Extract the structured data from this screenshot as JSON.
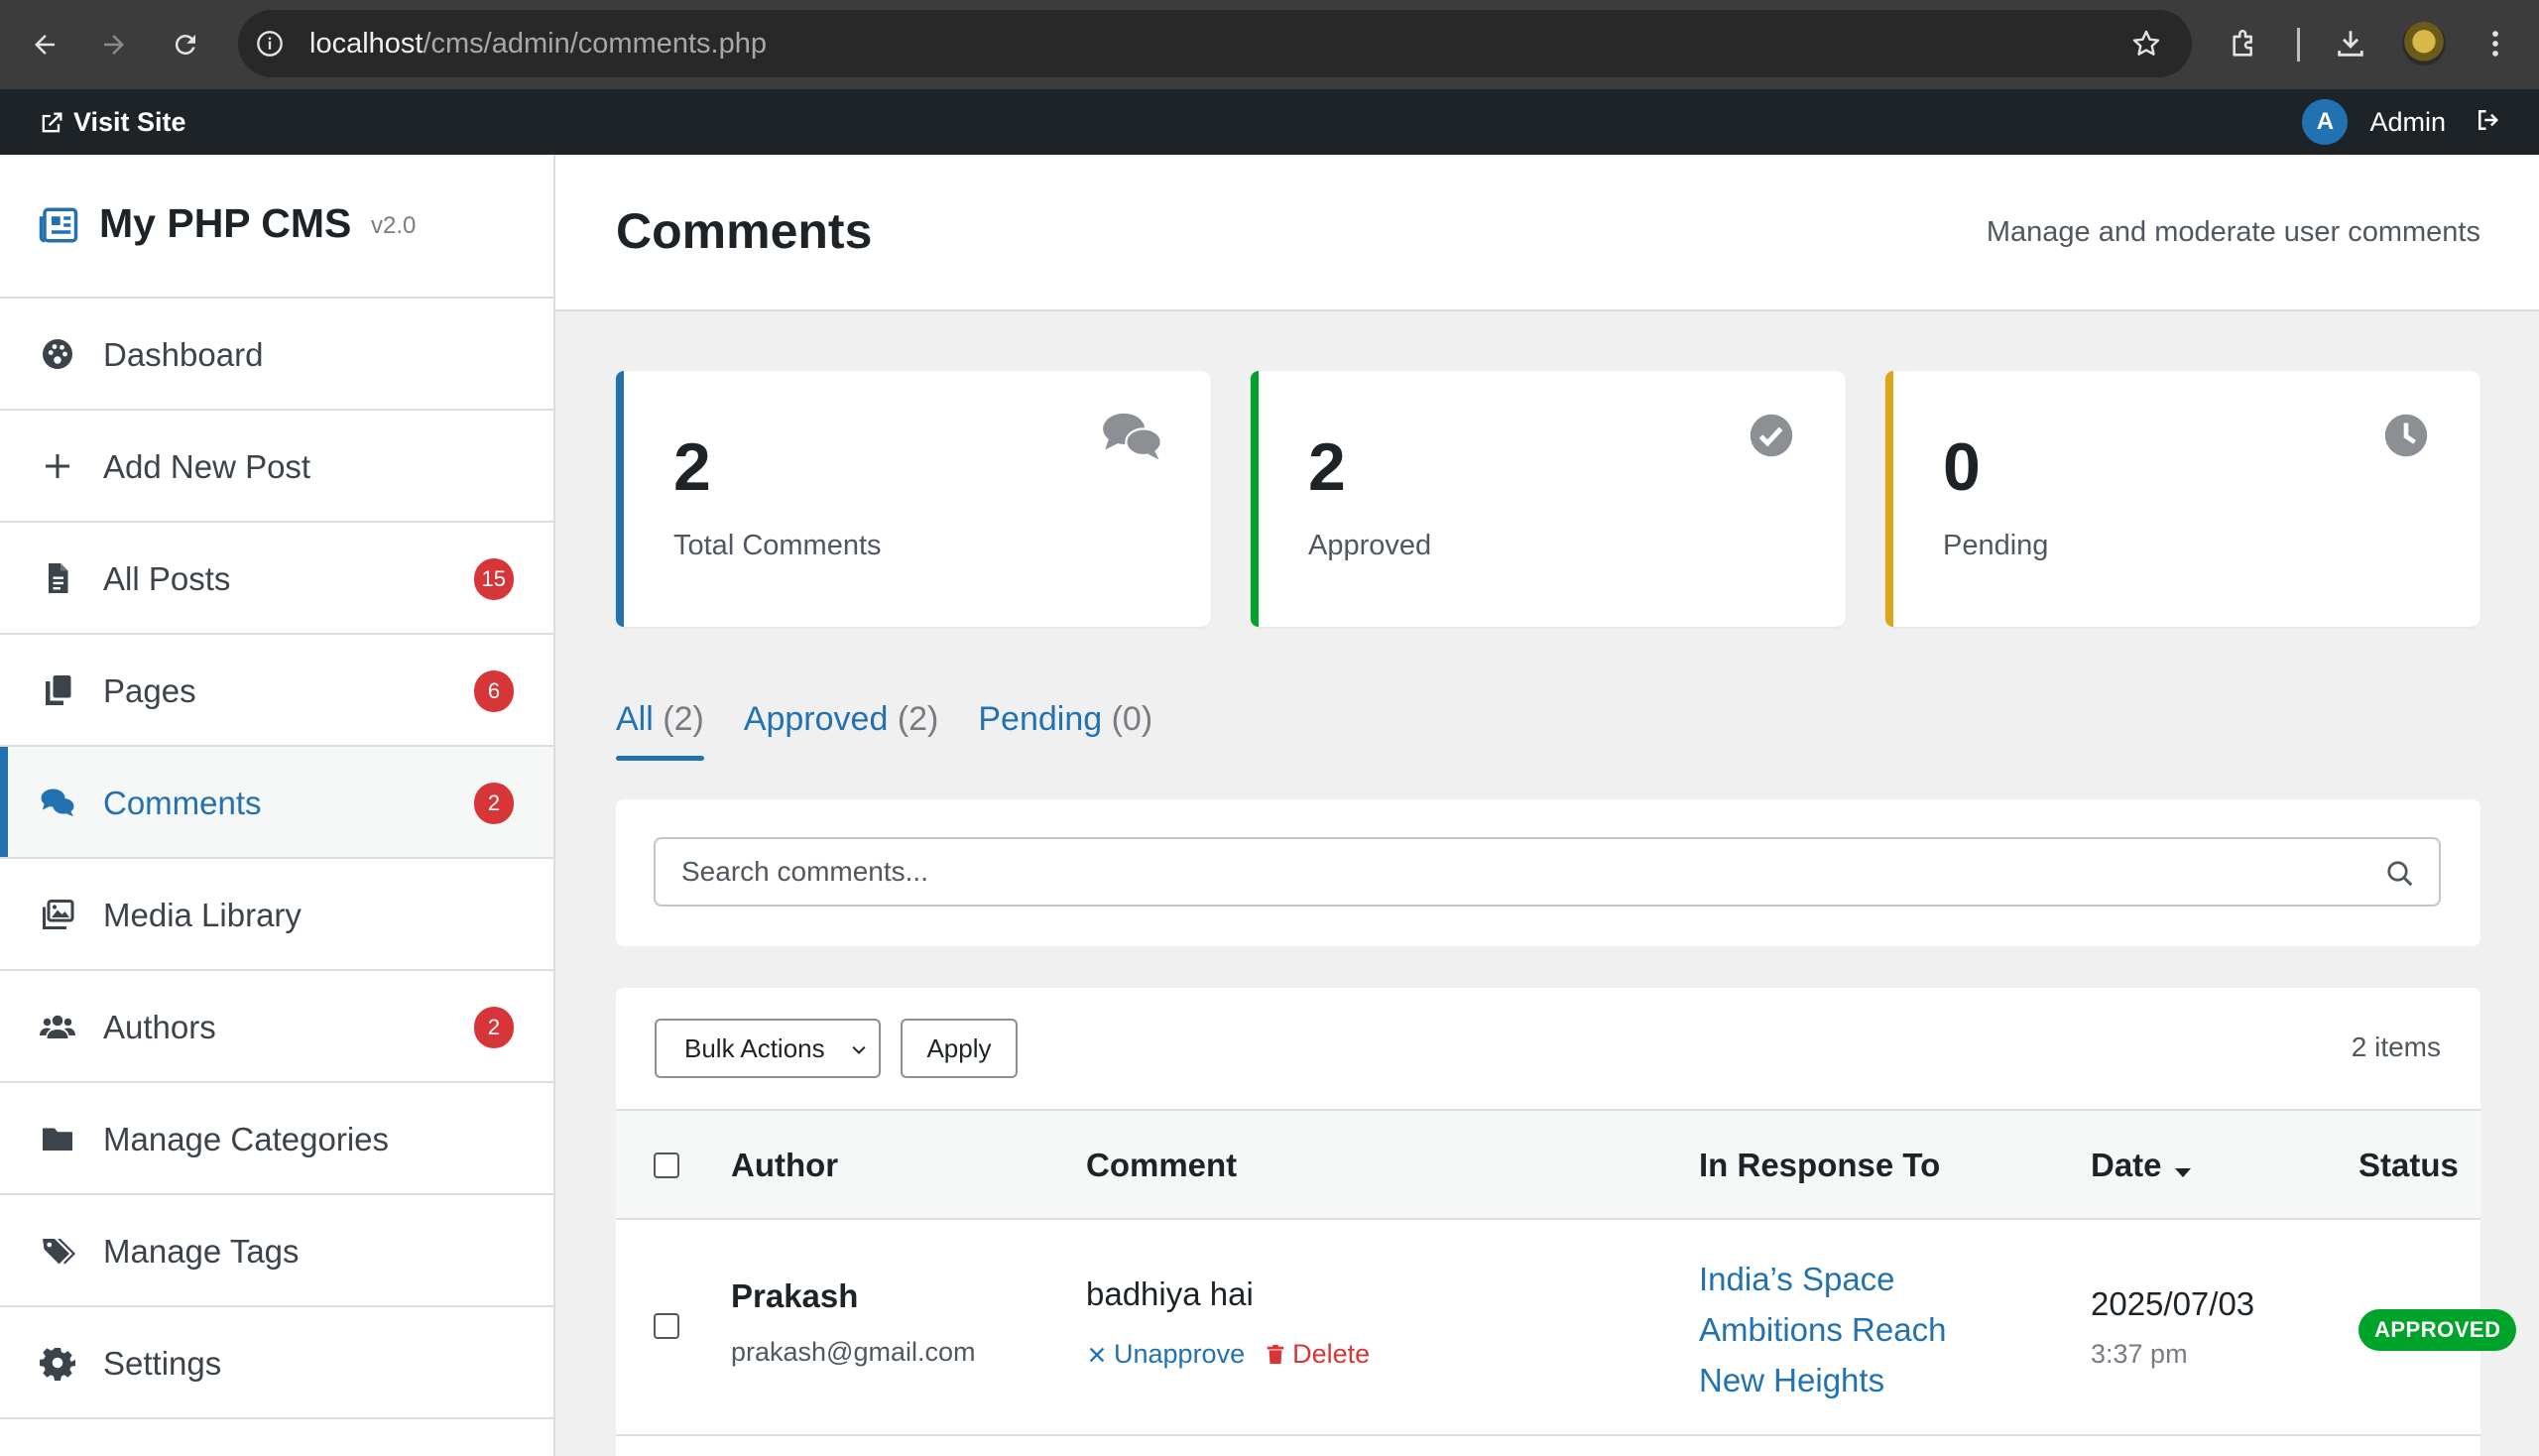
{
  "browser": {
    "url_host": "localhost",
    "url_path": "/cms/admin/comments.php"
  },
  "admin_bar": {
    "visit_site": "Visit Site",
    "avatar_letter": "A",
    "user_name": "Admin"
  },
  "brand": {
    "name": "My PHP CMS",
    "version": "v2.0"
  },
  "sidebar": {
    "items": [
      {
        "label": "Dashboard",
        "icon": "palette-icon",
        "badge": ""
      },
      {
        "label": "Add New Post",
        "icon": "plus-icon",
        "badge": ""
      },
      {
        "label": "All Posts",
        "icon": "file-icon",
        "badge": "15"
      },
      {
        "label": "Pages",
        "icon": "copy-icon",
        "badge": "6"
      },
      {
        "label": "Comments",
        "icon": "comments-icon",
        "badge": "2",
        "active": true
      },
      {
        "label": "Media Library",
        "icon": "images-icon",
        "badge": ""
      },
      {
        "label": "Authors",
        "icon": "users-icon",
        "badge": "2"
      },
      {
        "label": "Manage Categories",
        "icon": "folder-icon",
        "badge": ""
      },
      {
        "label": "Manage Tags",
        "icon": "tags-icon",
        "badge": ""
      },
      {
        "label": "Settings",
        "icon": "gear-icon",
        "badge": ""
      }
    ]
  },
  "page": {
    "title": "Comments",
    "subtitle": "Manage and moderate user comments"
  },
  "stats": [
    {
      "value": "2",
      "label": "Total Comments",
      "color": "#2271b1",
      "icon": "comments-icon"
    },
    {
      "value": "2",
      "label": "Approved",
      "color": "#00a32a",
      "icon": "check-circle-icon"
    },
    {
      "value": "0",
      "label": "Pending",
      "color": "#dba617",
      "icon": "clock-icon"
    }
  ],
  "tabs": [
    {
      "label": "All",
      "count": "(2)",
      "active": true
    },
    {
      "label": "Approved",
      "count": "(2)"
    },
    {
      "label": "Pending",
      "count": "(0)"
    }
  ],
  "search": {
    "placeholder": "Search comments..."
  },
  "toolbar": {
    "bulk_actions": "Bulk Actions",
    "apply": "Apply",
    "items_count": "2 items"
  },
  "table": {
    "columns": [
      "Author",
      "Comment",
      "In Response To",
      "Date",
      "Status"
    ],
    "rows": [
      {
        "author": "Prakash",
        "email": "prakash@gmail.com",
        "comment": "badhiya hai",
        "unapprove": "Unapprove",
        "delete": "Delete",
        "in_response_to": "India’s Space Ambitions Reach New Heights",
        "date": "2025/07/03",
        "time": "3:37 pm",
        "status": "APPROVED"
      }
    ]
  },
  "colors": {
    "accent": "#2271b1",
    "danger": "#d63638",
    "success": "#00a32a",
    "warning": "#dba617"
  }
}
